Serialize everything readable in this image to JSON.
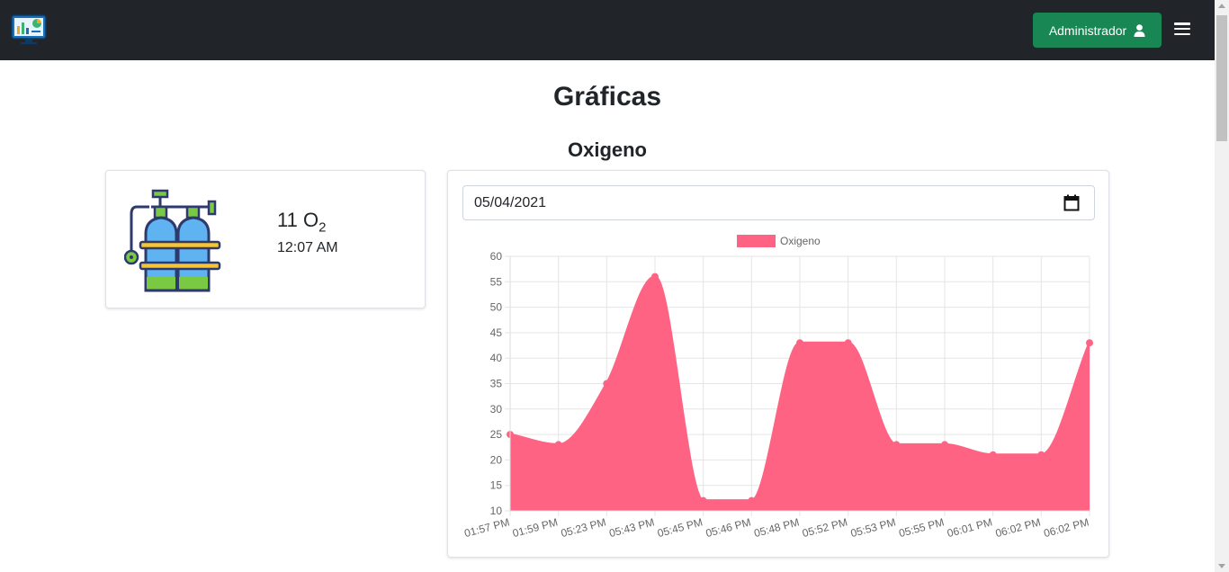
{
  "header": {
    "admin_label": "Administrador",
    "brand_icon": "chart-monitor-icon",
    "user_icon": "user-icon",
    "menu_icon": "hamburger-menu-icon"
  },
  "page": {
    "title": "Gráficas",
    "section_title": "Oxigeno"
  },
  "status_card": {
    "value": "11 O",
    "value_sub": "2",
    "time": "12:07 AM",
    "icon": "oxygen-tank-icon"
  },
  "date_filter": {
    "value": "05/04/2021",
    "icon": "calendar-icon"
  },
  "colors": {
    "navbar": "#212529",
    "button": "#198754",
    "series": "#ff6384"
  },
  "chart_data": {
    "type": "area",
    "title": "",
    "xlabel": "",
    "ylabel": "",
    "ylim": [
      10,
      60
    ],
    "yticks": [
      10,
      15,
      20,
      25,
      30,
      35,
      40,
      45,
      50,
      55,
      60
    ],
    "categories": [
      "01:57 PM",
      "01:59 PM",
      "05:23 PM",
      "05:43 PM",
      "05:45 PM",
      "05:46 PM",
      "05:48 PM",
      "05:52 PM",
      "05:53 PM",
      "05:55 PM",
      "06:01 PM",
      "06:02 PM",
      "06:02 PM"
    ],
    "series": [
      {
        "name": "Oxigeno",
        "values": [
          25,
          23,
          35,
          56,
          12,
          12,
          43,
          43,
          23,
          23,
          21,
          21,
          43
        ]
      }
    ],
    "legend": "top",
    "grid": true
  }
}
